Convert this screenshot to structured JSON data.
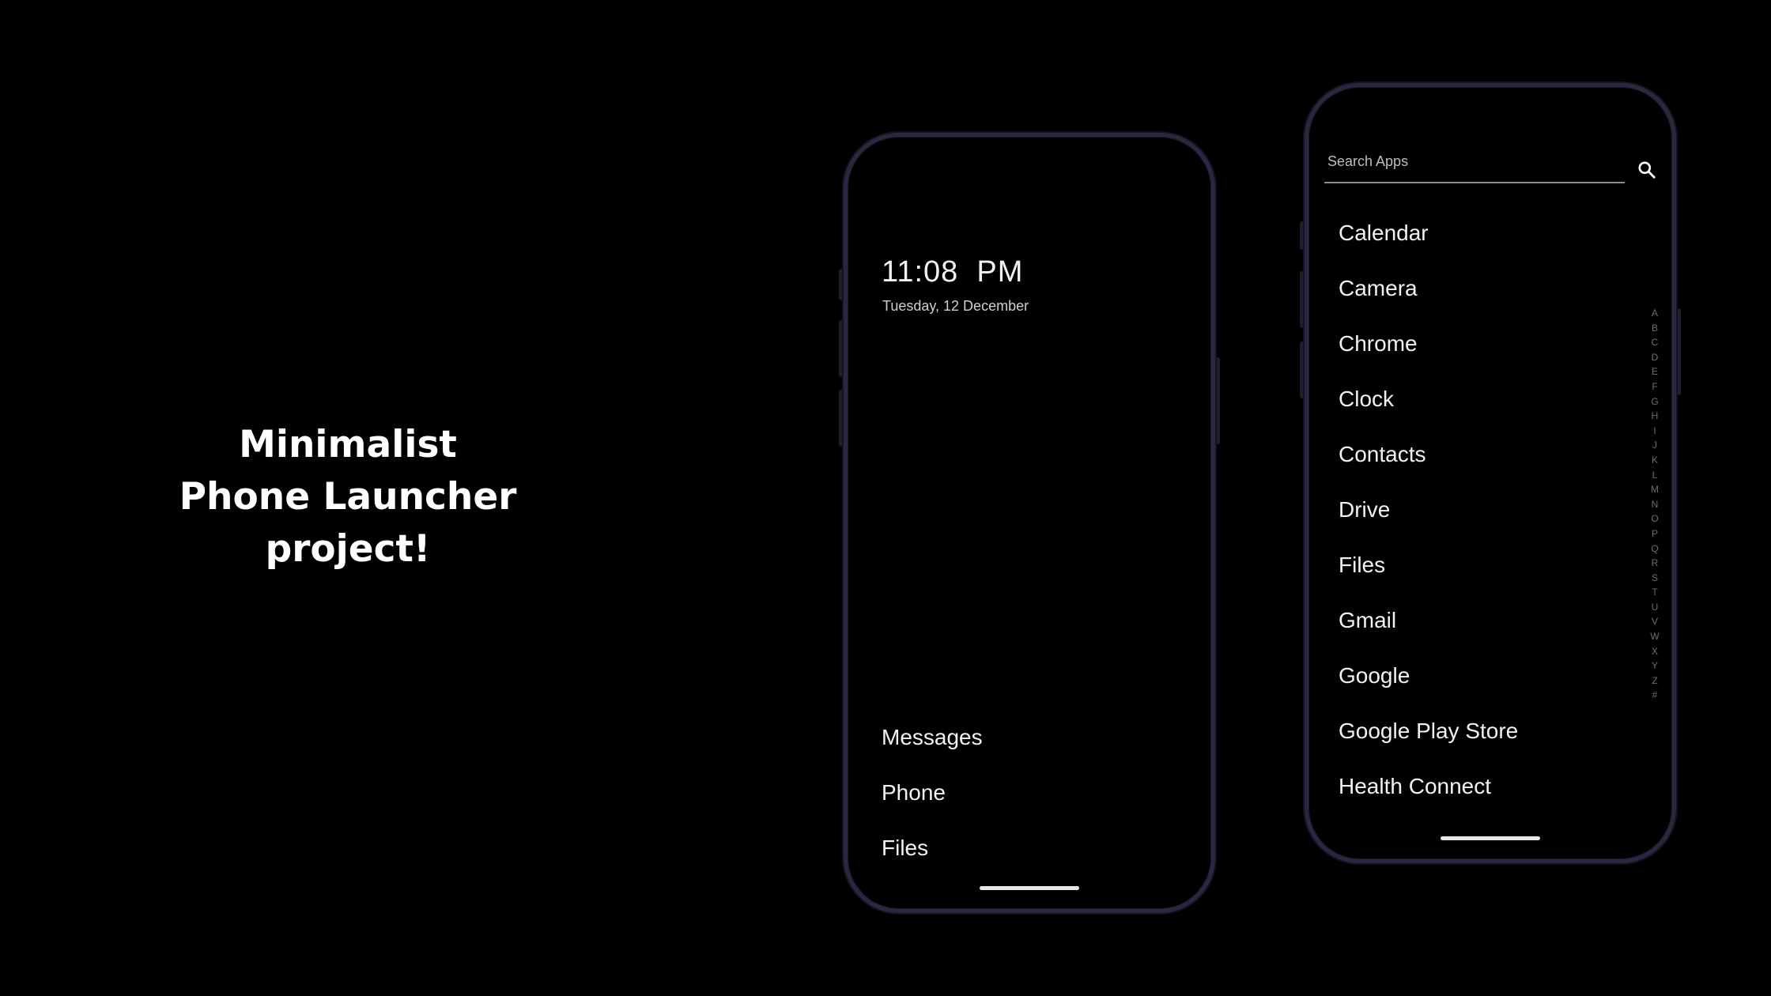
{
  "headline": {
    "line1": "Minimalist",
    "line2": "Phone Launcher",
    "line3": "project!"
  },
  "home_screen": {
    "time": "11:08  PM",
    "date": "Tuesday, 12 December",
    "favorites": [
      "Messages",
      "Phone",
      "Files"
    ]
  },
  "app_drawer": {
    "search": {
      "placeholder": "Search Apps",
      "value": "",
      "icon": "search-icon"
    },
    "apps": [
      "Calendar",
      "Camera",
      "Chrome",
      "Clock",
      "Contacts",
      "Drive",
      "Files",
      "Gmail",
      "Google",
      "Google Play Store",
      "Health Connect"
    ],
    "alphabet_index": [
      "A",
      "B",
      "C",
      "D",
      "E",
      "F",
      "G",
      "H",
      "I",
      "J",
      "K",
      "L",
      "M",
      "N",
      "O",
      "P",
      "Q",
      "R",
      "S",
      "T",
      "U",
      "V",
      "W",
      "X",
      "Y",
      "Z",
      "#"
    ]
  },
  "colors": {
    "background": "#000000",
    "phone_frame": "#2a2740",
    "text_primary": "#f2f2f2",
    "text_secondary": "#cfcfcf",
    "index_text": "#6e6e6e",
    "search_underline": "#8a8a8a"
  }
}
